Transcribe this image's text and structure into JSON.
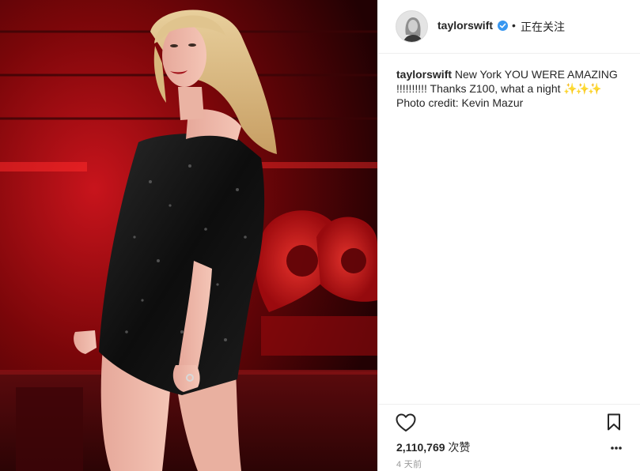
{
  "post": {
    "username": "taylorswift",
    "follow_state": "正在关注",
    "separator": "•",
    "caption": {
      "username": "taylorswift",
      "text": "New York YOU WERE AMAZING !!!!!!!!!! Thanks Z100, what a night",
      "emoji": "✨✨✨",
      "credit": "Photo credit: Kevin Mazur"
    },
    "likes": {
      "count": "2,110,769",
      "label": "次赞"
    },
    "timestamp": "4 天前"
  },
  "icons": {
    "verified": "verified-badge-icon",
    "like": "heart-outline-icon",
    "save": "bookmark-outline-icon",
    "more": "more-options-icon"
  },
  "colors": {
    "verified": "#3897f0",
    "text": "#262626",
    "muted": "#999999",
    "stage_red": "#c4121a"
  }
}
